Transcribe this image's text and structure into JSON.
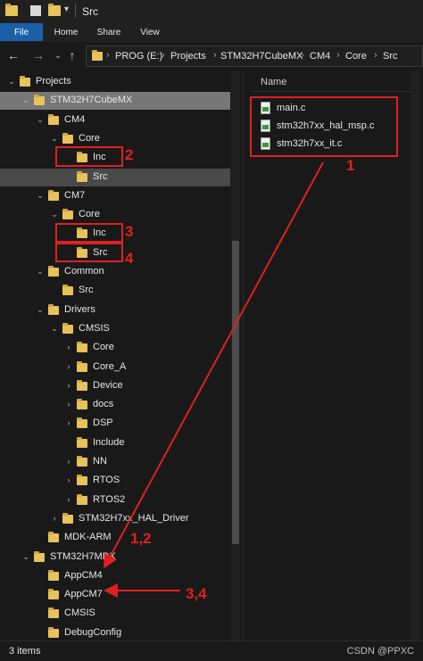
{
  "window": {
    "title": "Src"
  },
  "ribbon": {
    "tabs": [
      "File",
      "Home",
      "Share",
      "View"
    ]
  },
  "address": {
    "crumbs": [
      "PROG (E:)",
      "Projects",
      "STM32H7CubeMX",
      "CM4",
      "Core",
      "Src"
    ]
  },
  "tree": [
    {
      "label": "Projects",
      "indent": 0,
      "expanded": true,
      "state": ""
    },
    {
      "label": "STM32H7CubeMX",
      "indent": 1,
      "expanded": true,
      "state": "sel"
    },
    {
      "label": "CM4",
      "indent": 2,
      "expanded": true,
      "state": ""
    },
    {
      "label": "Core",
      "indent": 3,
      "expanded": true,
      "state": ""
    },
    {
      "label": "Inc",
      "indent": 4,
      "expanded": null,
      "state": ""
    },
    {
      "label": "Src",
      "indent": 4,
      "expanded": null,
      "state": "sel2"
    },
    {
      "label": "CM7",
      "indent": 2,
      "expanded": true,
      "state": ""
    },
    {
      "label": "Core",
      "indent": 3,
      "expanded": true,
      "state": ""
    },
    {
      "label": "Inc",
      "indent": 4,
      "expanded": null,
      "state": ""
    },
    {
      "label": "Src",
      "indent": 4,
      "expanded": null,
      "state": ""
    },
    {
      "label": "Common",
      "indent": 2,
      "expanded": true,
      "state": ""
    },
    {
      "label": "Src",
      "indent": 3,
      "expanded": null,
      "state": ""
    },
    {
      "label": "Drivers",
      "indent": 2,
      "expanded": true,
      "state": ""
    },
    {
      "label": "CMSIS",
      "indent": 3,
      "expanded": true,
      "state": ""
    },
    {
      "label": "Core",
      "indent": 4,
      "expanded": false,
      "state": ""
    },
    {
      "label": "Core_A",
      "indent": 4,
      "expanded": false,
      "state": ""
    },
    {
      "label": "Device",
      "indent": 4,
      "expanded": false,
      "state": ""
    },
    {
      "label": "docs",
      "indent": 4,
      "expanded": false,
      "state": ""
    },
    {
      "label": "DSP",
      "indent": 4,
      "expanded": false,
      "state": ""
    },
    {
      "label": "Include",
      "indent": 4,
      "expanded": null,
      "state": ""
    },
    {
      "label": "NN",
      "indent": 4,
      "expanded": false,
      "state": ""
    },
    {
      "label": "RTOS",
      "indent": 4,
      "expanded": false,
      "state": ""
    },
    {
      "label": "RTOS2",
      "indent": 4,
      "expanded": false,
      "state": ""
    },
    {
      "label": "STM32H7xx_HAL_Driver",
      "indent": 3,
      "expanded": false,
      "state": ""
    },
    {
      "label": "MDK-ARM",
      "indent": 2,
      "expanded": null,
      "state": ""
    },
    {
      "label": "STM32H7MDK",
      "indent": 1,
      "expanded": true,
      "state": ""
    },
    {
      "label": "AppCM4",
      "indent": 2,
      "expanded": null,
      "state": ""
    },
    {
      "label": "AppCM7",
      "indent": 2,
      "expanded": null,
      "state": ""
    },
    {
      "label": "CMSIS",
      "indent": 2,
      "expanded": null,
      "state": ""
    },
    {
      "label": "DebugConfig",
      "indent": 2,
      "expanded": null,
      "state": ""
    }
  ],
  "files": {
    "column": "Name",
    "items": [
      "main.c",
      "stm32h7xx_hal_msp.c",
      "stm32h7xx_it.c"
    ]
  },
  "status": {
    "count": "3 items",
    "watermark": "CSDN @PPXC"
  },
  "annotations": [
    "1",
    "2",
    "3",
    "4",
    "1,2",
    "3,4"
  ],
  "colors": {
    "accent": "#1b5fa8",
    "folder": "#e8c25a",
    "annotation": "#e02020",
    "selected_row": "#777777"
  }
}
